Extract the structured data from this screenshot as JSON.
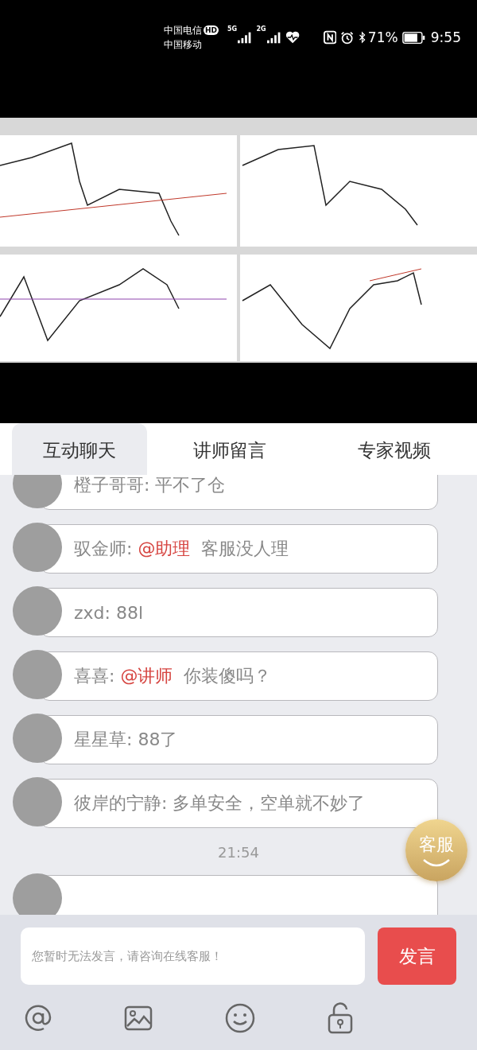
{
  "status_bar": {
    "carrier_1": "中国电信",
    "hd_badge": "HD",
    "carrier_2": "中国移动",
    "signal_1_label": "5G",
    "signal_2_label": "2G",
    "battery_percent": "71%",
    "time": "9:55"
  },
  "tabs": [
    {
      "label": "互动聊天",
      "selected": true
    },
    {
      "label": "讲师留言",
      "selected": false
    },
    {
      "label": "专家视频",
      "selected": false
    }
  ],
  "messages": [
    {
      "kind": "message",
      "author": "橙子哥哥:",
      "text": "平不了仓"
    },
    {
      "kind": "message",
      "author": "驭金师:",
      "mention": "@助理",
      "text": "客服没人理"
    },
    {
      "kind": "message",
      "author": "zxd:",
      "text": "88l"
    },
    {
      "kind": "message",
      "author": "喜喜:",
      "mention": "@讲师",
      "text": "你装傻吗？"
    },
    {
      "kind": "message",
      "author": "星星草:",
      "text": "88了"
    },
    {
      "kind": "message",
      "author": "彼岸的宁静:",
      "text": "多单安全，空单就不妙了"
    },
    {
      "kind": "time",
      "text": "21:54"
    },
    {
      "kind": "cut_message"
    }
  ],
  "service_button": {
    "label": "客服"
  },
  "composer": {
    "placeholder": "您暂时无法发言，请咨询在线客服！",
    "send_label": "发言"
  }
}
